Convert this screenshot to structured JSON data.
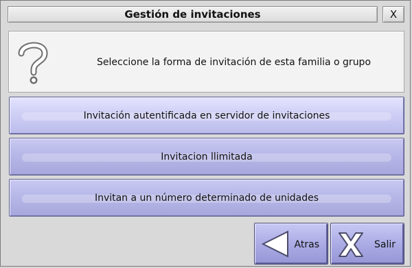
{
  "dialog": {
    "title": "Gestión de invitaciones",
    "close_label": "X"
  },
  "prompt": {
    "icon": "question-mark-icon",
    "text": "Seleccione la forma de invitación de esta familia o grupo"
  },
  "options": [
    {
      "label": "Invitación autentificada en servidor de invitaciones"
    },
    {
      "label": "Invitacion llimitada"
    },
    {
      "label": "Invitan a un número determinado de unidades"
    }
  ],
  "nav": {
    "back": {
      "label": "Atras",
      "icon": "back-arrow-icon"
    },
    "exit": {
      "label": "Salir",
      "icon": "exit-x-icon"
    }
  },
  "colors": {
    "option_fill": "#cfcff6",
    "option_border": "#5b5b8f",
    "nav_fill": "#a9a9e4"
  }
}
